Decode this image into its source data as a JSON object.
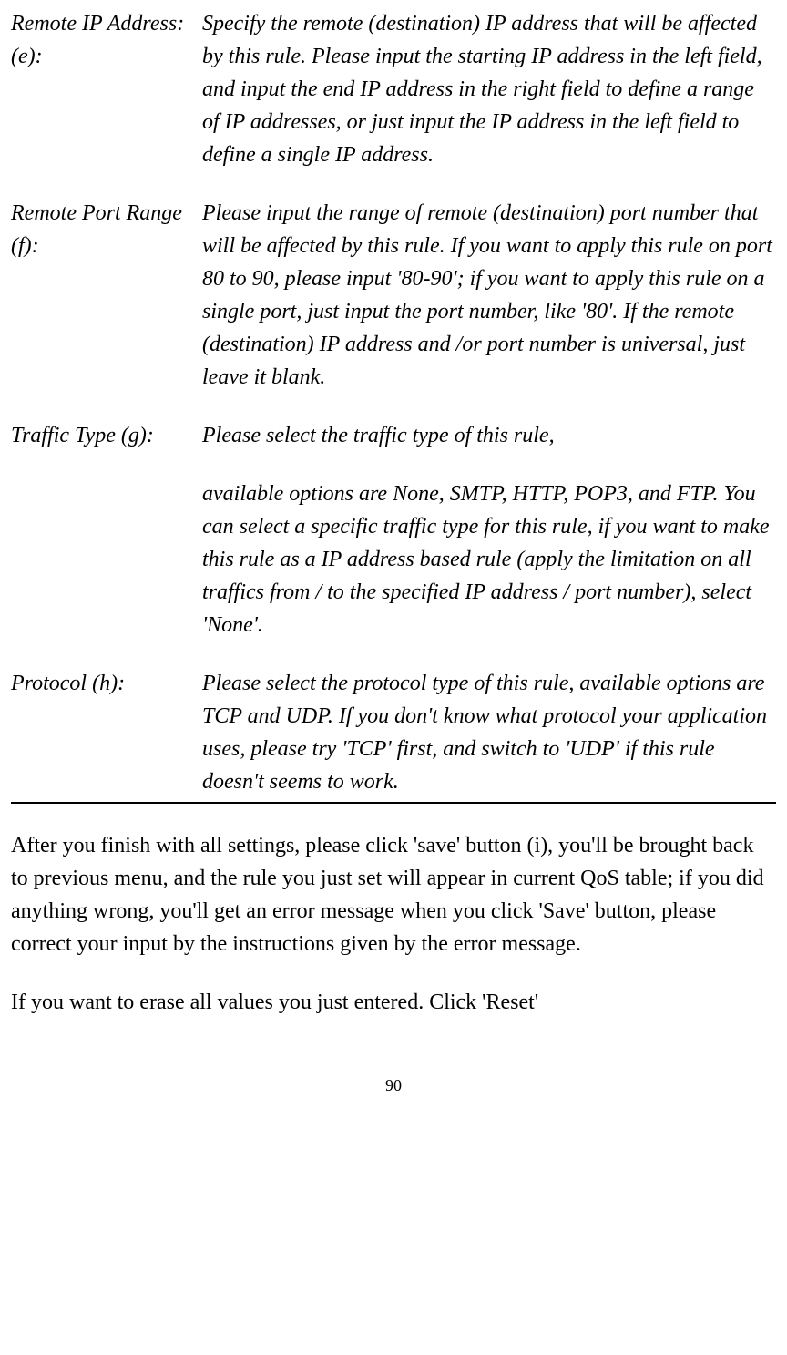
{
  "definitions": [
    {
      "term": "Remote IP Address: (e):",
      "paragraphs": [
        "Specify the remote (destination) IP address that will be affected by this rule. Please input the starting IP address in the left field, and input the end IP address in the right field to define a range of IP addresses, or just input the IP address in the left field to define a single IP address."
      ]
    },
    {
      "term": "Remote Port Range (f):",
      "paragraphs": [
        "Please input the range of remote (destination) port number that will be affected by this rule. If you want to apply this rule on port 80 to 90, please input '80-90'; if you want to apply this rule on a single port, just input the port number, like '80'. If the remote (destination) IP address and /or port number is universal, just leave it blank."
      ]
    },
    {
      "term": "Traffic Type (g):",
      "paragraphs": [
        "Please select the traffic type of this rule,",
        "available options are None, SMTP, HTTP, POP3, and FTP. You can select a specific traffic type for this rule, if you want to make this rule as a IP address based rule (apply the limitation on all traffics from / to the specified IP address / port number), select 'None'."
      ]
    },
    {
      "term": "Protocol (h):",
      "paragraphs": [
        "Please select the protocol type of this rule, available options are TCP and UDP. If you don't know what protocol your application uses, please try 'TCP' first, and switch to 'UDP' if this rule doesn't seems to work."
      ]
    }
  ],
  "body": [
    "After you finish with all settings, please click 'save' button (i), you'll be brought back to previous menu, and the rule you just set will appear in current QoS table; if you did anything wrong, you'll get an error message when you click 'Save' button, please correct your input by the instructions given by the error message.",
    "If you want to erase all values you just entered. Click 'Reset'"
  ],
  "pageNumber": "90"
}
